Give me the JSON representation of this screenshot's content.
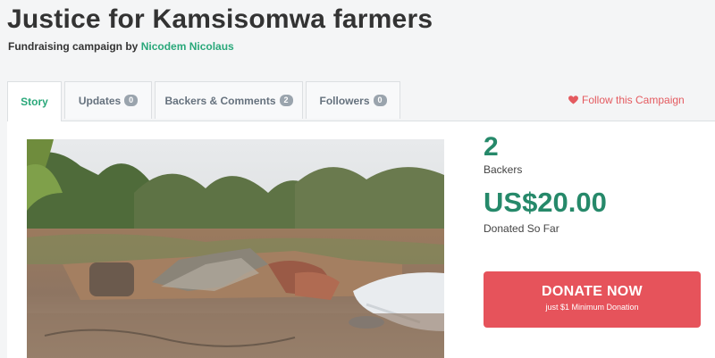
{
  "campaign": {
    "title": "Justice for Kamsisomwa farmers",
    "subtitle_prefix": "Fundraising campaign by",
    "organizer": "Nicodem Nicolaus"
  },
  "tabs": [
    {
      "label": "Story",
      "count": null,
      "active": true
    },
    {
      "label": "Updates",
      "count": "0"
    },
    {
      "label": "Backers & Comments",
      "count": "2"
    },
    {
      "label": "Followers",
      "count": "0"
    }
  ],
  "follow": {
    "label": "Follow this Campaign",
    "icon": "heart-icon"
  },
  "stats": {
    "backers_value": "2",
    "backers_label": "Backers",
    "donated_value": "US$20.00",
    "donated_label": "Donated So Far"
  },
  "donate": {
    "label": "DONATE NOW",
    "sublabel": "just $1 Minimum Donation"
  },
  "colors": {
    "accent_green": "#2aa87a",
    "stat_green": "#26896a",
    "donate_red": "#e6535b",
    "follow_red": "#e45a5f"
  }
}
